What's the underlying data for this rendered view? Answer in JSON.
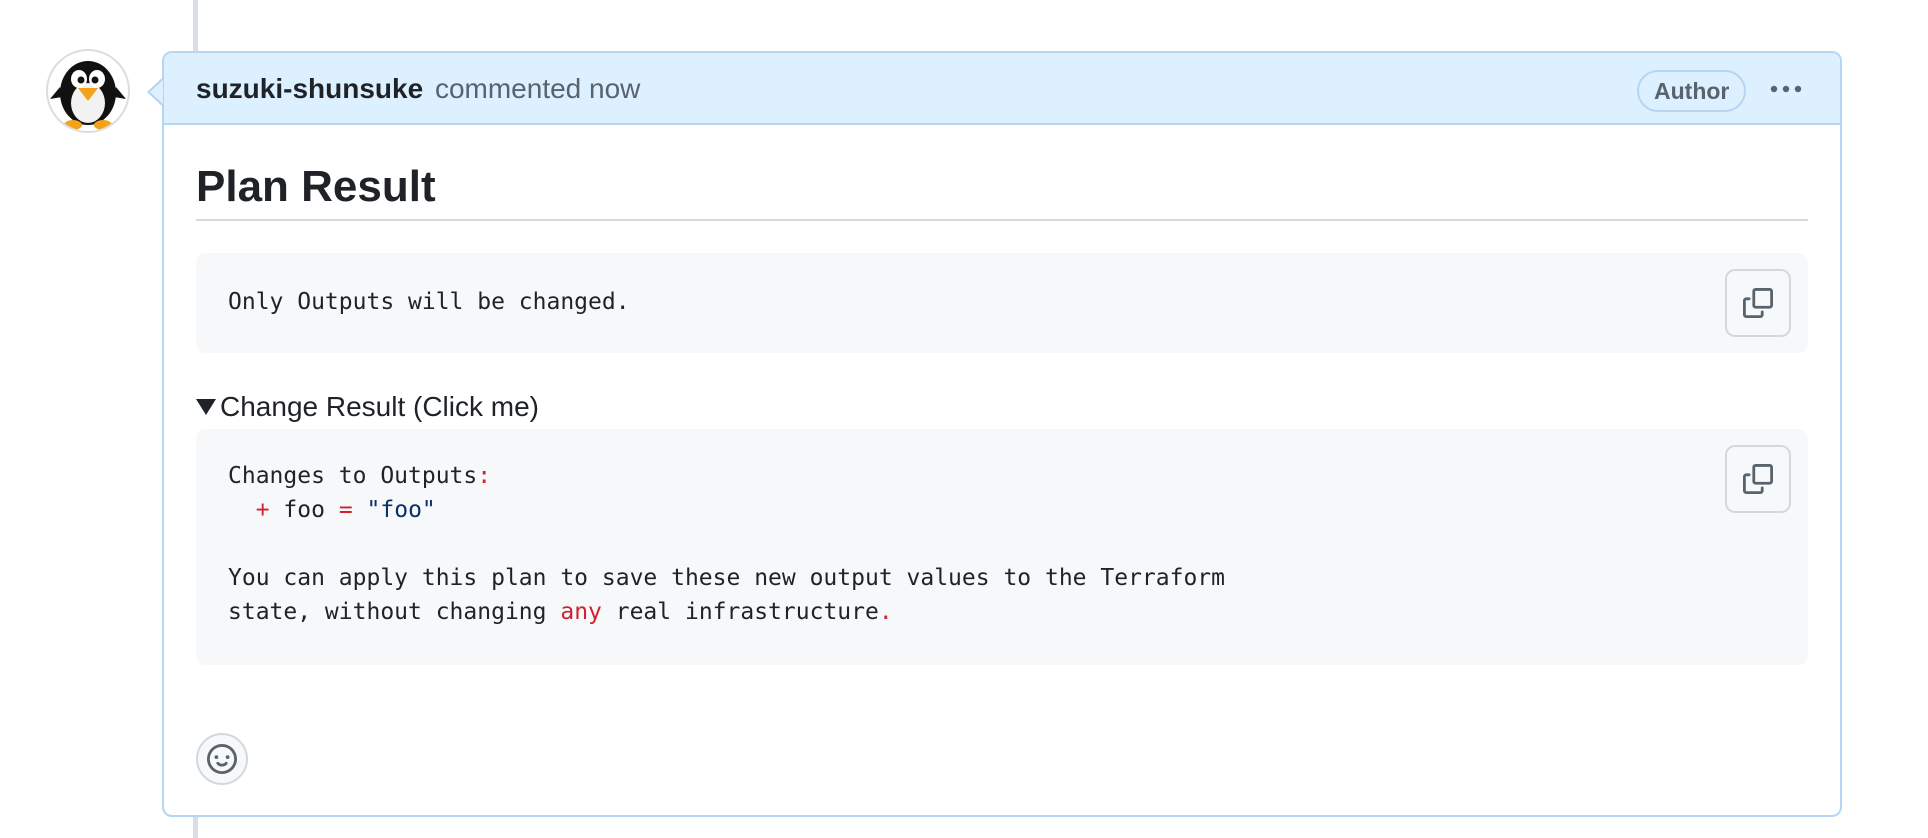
{
  "comment": {
    "author": "suzuki-shunsuke",
    "meta": "commented now",
    "badge": "Author",
    "more_icon": "kebab-horizontal-icon"
  },
  "body": {
    "title": "Plan Result",
    "summary_line": "Only Outputs will be changed.",
    "details_summary": "Change Result (Click me)",
    "details_code": {
      "line1_text": "Changes to Outputs",
      "line1_colon": ":",
      "line2_indent": "  ",
      "line2_plus": "+",
      "line2_name": " foo ",
      "line2_eq": "=",
      "line2_value": "\"foo\"",
      "line4": "You can apply this plan to save these new output values to the Terraform",
      "line5_a": "state, without changing ",
      "line5_any": "any",
      "line5_b": " real infrastructure",
      "line5_dot": "."
    }
  },
  "icons": {
    "copy": "copy-icon",
    "reaction": "smiley-icon",
    "avatar": "penguin-avatar"
  },
  "colors": {
    "header_bg": "#ddf0ff",
    "border": "#b6d5f2",
    "code_bg": "#f6f8fa",
    "keyword_red": "#cf222e",
    "string_blue": "#0a3069"
  }
}
